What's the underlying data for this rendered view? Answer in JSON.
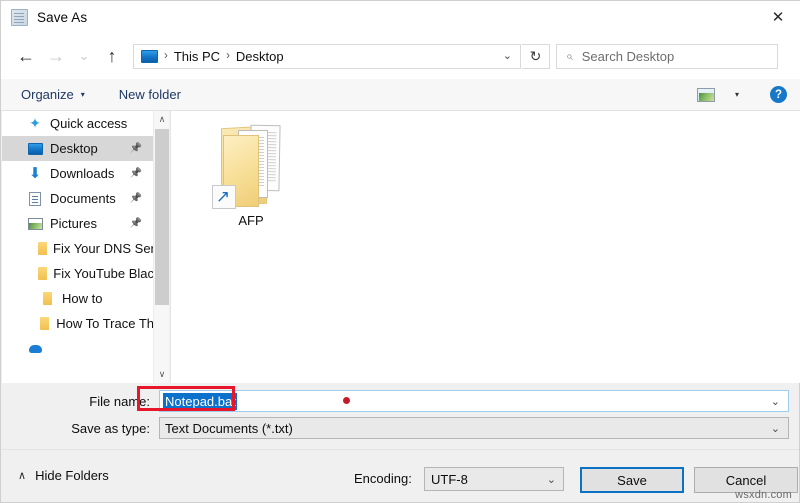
{
  "window": {
    "title": "Save As",
    "icon": "notepad-icon",
    "close_label": "✕"
  },
  "navbar": {
    "back_icon": "←",
    "forward_icon": "→",
    "recent_icon": "⌄",
    "up_icon": "↑",
    "breadcrumb": [
      "This PC",
      "Desktop"
    ],
    "separator": "›",
    "dropdown_icon": "⌄",
    "refresh_icon": "↻",
    "search_placeholder": "Search Desktop",
    "search_value": "",
    "search_icon": "⌕"
  },
  "commandbar": {
    "organize_label": "Organize",
    "organize_caret": "▾",
    "new_folder_label": "New folder",
    "view_caret": "▾",
    "help_label": "?"
  },
  "sidebar": {
    "items": [
      {
        "label": "Quick access",
        "icon": "star-icon",
        "icon_class": "ic-star",
        "glyph": "✦",
        "indent": false,
        "selected": false,
        "pinned": false
      },
      {
        "label": "Desktop",
        "icon": "desktop-icon",
        "icon_class": "ic-desktop",
        "glyph": "",
        "indent": false,
        "selected": true,
        "pinned": true
      },
      {
        "label": "Downloads",
        "icon": "download-icon",
        "icon_class": "ic-down",
        "glyph": "⬇",
        "indent": false,
        "selected": false,
        "pinned": true
      },
      {
        "label": "Documents",
        "icon": "documents-icon",
        "icon_class": "ic-doc",
        "glyph": "",
        "indent": false,
        "selected": false,
        "pinned": true
      },
      {
        "label": "Pictures",
        "icon": "pictures-icon",
        "icon_class": "ic-pic",
        "glyph": "",
        "indent": false,
        "selected": false,
        "pinned": true
      },
      {
        "label": "Fix Your DNS Ser",
        "icon": "folder-icon",
        "icon_class": "ic-folder",
        "glyph": "",
        "indent": true,
        "selected": false,
        "pinned": false
      },
      {
        "label": "Fix YouTube Blac",
        "icon": "folder-icon",
        "icon_class": "ic-folder",
        "glyph": "",
        "indent": true,
        "selected": false,
        "pinned": false
      },
      {
        "label": "How to",
        "icon": "folder-icon",
        "icon_class": "ic-folder",
        "glyph": "",
        "indent": true,
        "selected": false,
        "pinned": false
      },
      {
        "label": "How To Trace Th",
        "icon": "folder-icon",
        "icon_class": "ic-folder",
        "glyph": "",
        "indent": true,
        "selected": false,
        "pinned": false
      },
      {
        "label": "",
        "icon": "cloud-icon",
        "icon_class": "ic-cloud",
        "glyph": "",
        "indent": false,
        "selected": false,
        "pinned": false
      }
    ],
    "scroll_up_icon": "∧",
    "scroll_down_icon": "∨"
  },
  "filepane": {
    "items": [
      {
        "label": "AFP",
        "icon": "folder-shortcut-icon",
        "shortcut_arrow": "↗"
      }
    ]
  },
  "form": {
    "filename_label": "File name:",
    "filename_value": "Notepad.bat",
    "filename_chevron": "⌄",
    "filetype_label": "Save as type:",
    "filetype_value": "Text Documents (*.txt)",
    "filetype_chevron": "⌄"
  },
  "footer": {
    "hide_folders_label": "Hide Folders",
    "hide_folders_caret": "∧",
    "encoding_label": "Encoding:",
    "encoding_value": "UTF-8",
    "encoding_chevron": "⌄",
    "save_label": "Save",
    "cancel_label": "Cancel"
  },
  "watermark": {
    "text": "wsxdn.com"
  },
  "annotations": {
    "highlight_color": "#e8162a",
    "dot_color": "#c41a2b"
  }
}
